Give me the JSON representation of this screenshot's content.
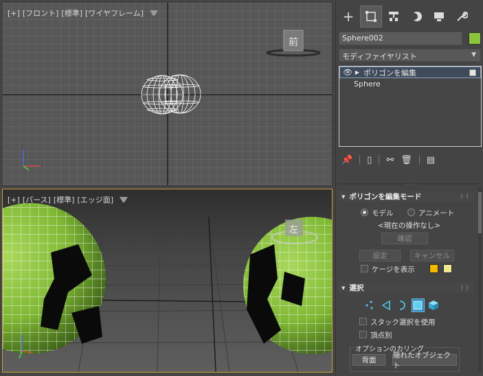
{
  "viewport_top": {
    "label_parts": [
      "[+]",
      "[フロント]",
      "[標準]",
      "[ワイヤフレーム]"
    ],
    "cube_face": "前"
  },
  "viewport_perspective": {
    "label_parts": [
      "[+]",
      "[パース]",
      "[標準]",
      "[エッジ面]"
    ],
    "cube_face": "左"
  },
  "command_panel": {
    "tabs": [
      {
        "name": "create",
        "glyph": "+"
      },
      {
        "name": "modify",
        "glyph": "⌗"
      },
      {
        "name": "hierarchy",
        "glyph": "⊤"
      },
      {
        "name": "motion",
        "glyph": "◐"
      },
      {
        "name": "display",
        "glyph": "▬"
      },
      {
        "name": "utilities",
        "glyph": "🔧"
      }
    ],
    "object_name": "Sphere002",
    "object_color": "#8cc43c",
    "modifier_list": "モディファイヤリスト",
    "stack": {
      "items": [
        {
          "label": "ポリゴンを編集"
        },
        {
          "label": "Sphere"
        }
      ]
    },
    "rollout_edit_poly": {
      "title": "ポリゴンを編集モード",
      "model_label": "モデル",
      "animate_label": "アニメート",
      "current_op": "<現在の操作なし>",
      "commit_label": "確認",
      "settings_label": "設定",
      "cancel_label": "キャンセル",
      "show_cage_label": "ケージを表示",
      "cage_color_1": "#f5b800",
      "cage_color_2": "#f0e890"
    },
    "rollout_selection": {
      "title": "選択",
      "use_stack_label": "スタック選択を使用",
      "by_vertex_label": "頂点別",
      "culling_group_label": "オプションのカリング",
      "backface_label": "背面",
      "occluded_label": "隠れたオブジェクト"
    }
  }
}
